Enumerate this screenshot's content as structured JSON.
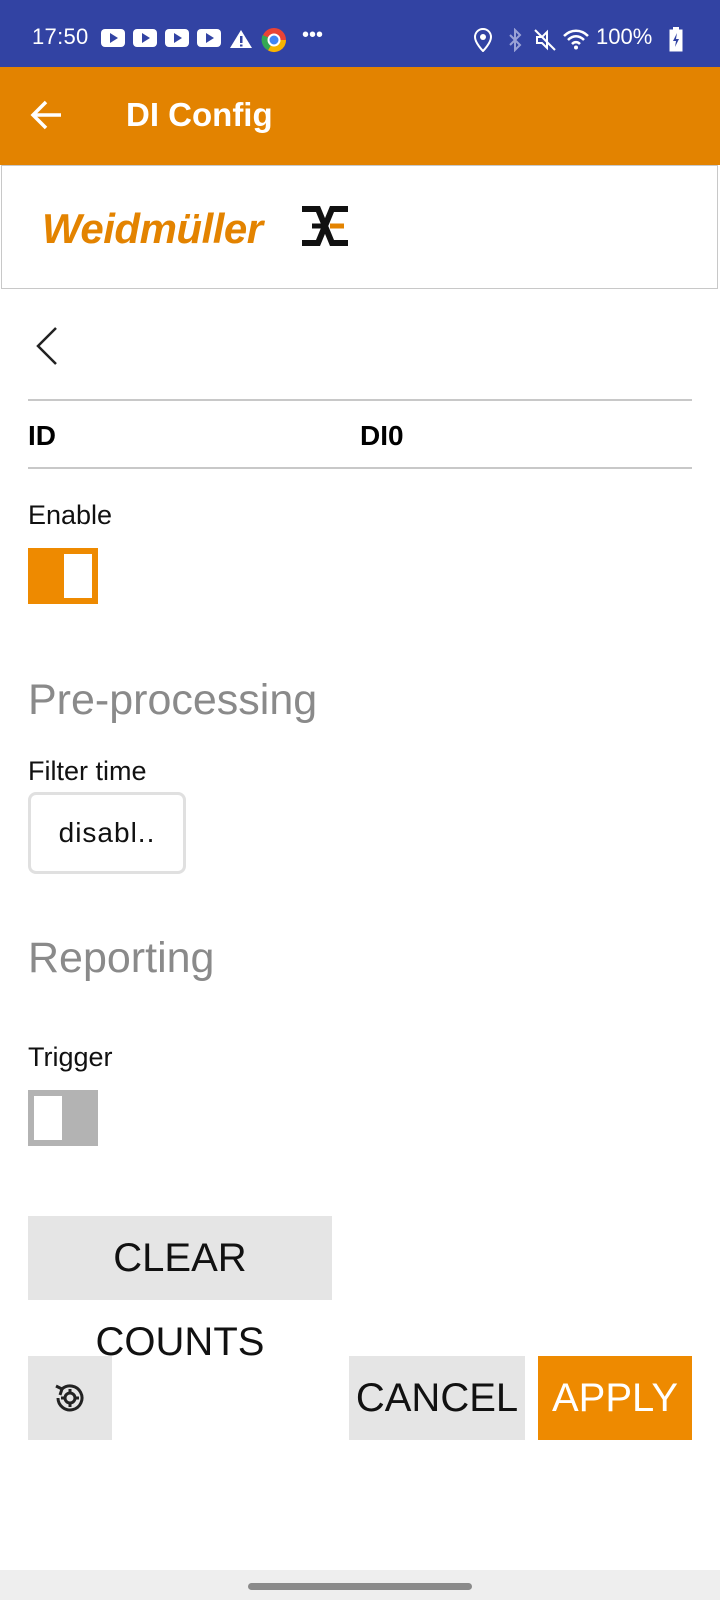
{
  "status_bar": {
    "time": "17:50",
    "battery": "100%",
    "icons": [
      "youtube-icon",
      "youtube-icon",
      "youtube-icon",
      "youtube-icon",
      "warning-icon",
      "chrome-icon",
      "more-icon",
      "location-icon",
      "bluetooth-icon",
      "mute-icon",
      "wifi-icon",
      "battery-icon"
    ]
  },
  "app_bar": {
    "title": "DI Config",
    "back_icon": "arrow-left-icon"
  },
  "logo": {
    "text": "Weidmüller"
  },
  "form": {
    "id_label": "ID",
    "id_value": "DI0",
    "enable_label": "Enable",
    "enable_on": true,
    "preprocessing_title": "Pre-processing",
    "filter_label": "Filter time",
    "filter_value": "disabl..",
    "reporting_title": "Reporting",
    "trigger_label": "Trigger",
    "trigger_on": false
  },
  "buttons": {
    "clear_counts": "CLEAR COUNTS",
    "cancel": "CANCEL",
    "apply": "APPLY"
  },
  "colors": {
    "status_bar": "#3243a3",
    "accent": "#e38300",
    "toggle_on": "#ee8a00",
    "toggle_off": "#b3b3b3",
    "section_title": "#8a8a8a"
  }
}
